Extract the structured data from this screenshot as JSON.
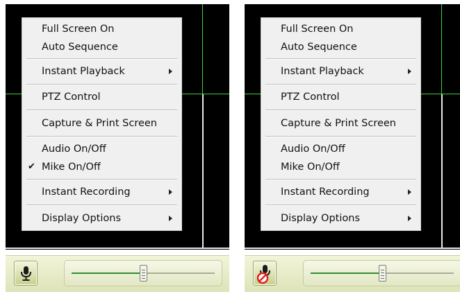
{
  "panels": [
    {
      "id": "left",
      "menu": {
        "items": [
          {
            "label": "Full Screen On",
            "checked": false,
            "submenu": false
          },
          {
            "label": "Auto Sequence",
            "checked": false,
            "submenu": false
          },
          {
            "label": "Instant Playback",
            "checked": false,
            "submenu": true
          },
          {
            "label": "PTZ Control",
            "checked": false,
            "submenu": false
          },
          {
            "label": "Capture & Print Screen",
            "checked": false,
            "submenu": false
          },
          {
            "label": "Audio On/Off",
            "checked": false,
            "submenu": false
          },
          {
            "label": "Mike On/Off",
            "checked": true,
            "submenu": false
          },
          {
            "label": "Instant Recording",
            "checked": false,
            "submenu": true
          },
          {
            "label": "Display Options",
            "checked": false,
            "submenu": true
          }
        ]
      },
      "mic_button": {
        "icon": "microphone-icon",
        "muted": false
      },
      "volume_slider": {
        "level": 0.5
      }
    },
    {
      "id": "right",
      "menu": {
        "items": [
          {
            "label": "Full Screen On",
            "checked": false,
            "submenu": false
          },
          {
            "label": "Auto Sequence",
            "checked": false,
            "submenu": false
          },
          {
            "label": "Instant Playback",
            "checked": false,
            "submenu": true
          },
          {
            "label": "PTZ Control",
            "checked": false,
            "submenu": false
          },
          {
            "label": "Capture & Print Screen",
            "checked": false,
            "submenu": false
          },
          {
            "label": "Audio On/Off",
            "checked": false,
            "submenu": false
          },
          {
            "label": "Mike On/Off",
            "checked": false,
            "submenu": false
          },
          {
            "label": "Instant Recording",
            "checked": false,
            "submenu": true
          },
          {
            "label": "Display Options",
            "checked": false,
            "submenu": true
          }
        ]
      },
      "mic_button": {
        "icon": "microphone-muted-icon",
        "muted": true
      },
      "volume_slider": {
        "level": 0.5
      }
    }
  ],
  "check_glyph": "✔",
  "colors": {
    "grid_line": "#3fd33f",
    "video_bg": "#000000",
    "menu_bg": "#f0f0f0",
    "slider_fill": "#2e8b2e",
    "mute_badge": "#e02020"
  }
}
